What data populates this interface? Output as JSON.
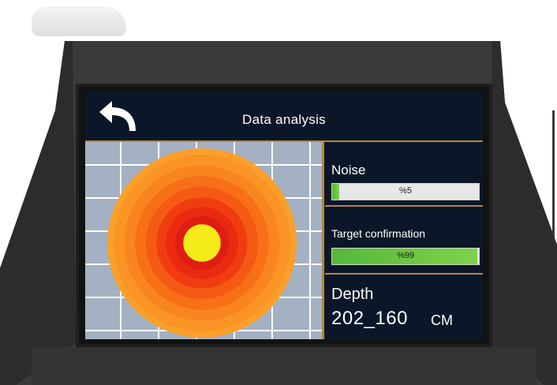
{
  "screen": {
    "title": "Data analysis",
    "back_icon": "back-arrow-icon"
  },
  "panels": {
    "noise": {
      "label": "Noise",
      "value_text": "%5",
      "level": 0.05
    },
    "target": {
      "label": "Target confirmation",
      "value_text": "%99",
      "level": 0.99
    },
    "depth": {
      "label": "Depth",
      "value": "202_160",
      "unit": "CM"
    }
  },
  "colors": {
    "accent_border": "#b3873f",
    "screen_bg": "#0e1a2b",
    "bar_green": "#55b83a",
    "heat_core": "#f5ea1a",
    "heat_red": "#e01d12",
    "heat_orange": "#fb9f2b"
  }
}
